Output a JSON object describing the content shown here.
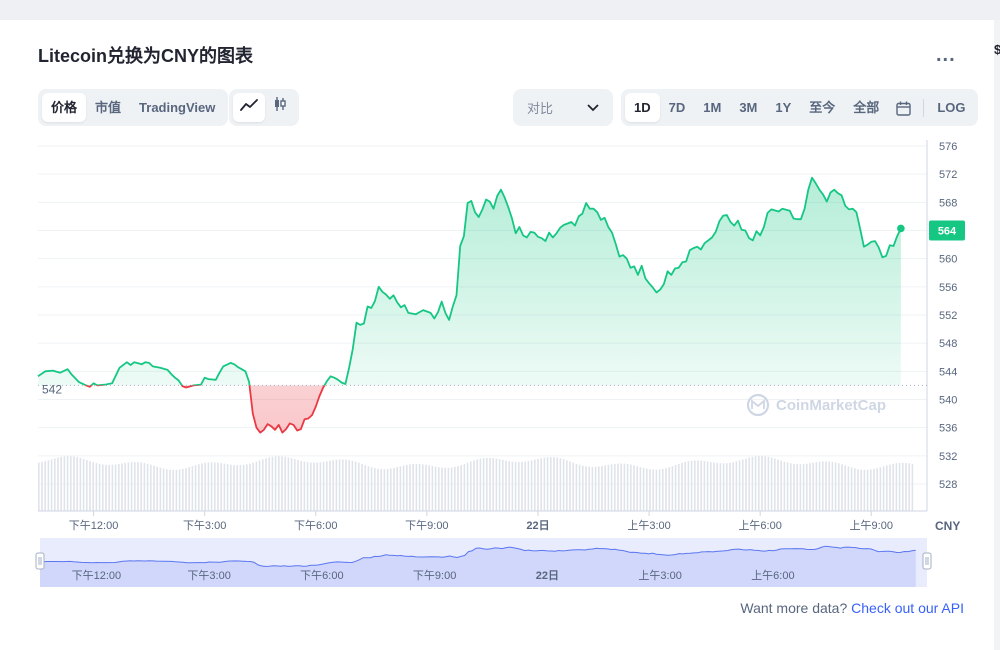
{
  "header": {
    "title": "Litecoin兑换为CNY的图表",
    "more_label": "..."
  },
  "tabs": {
    "price": "价格",
    "market_cap": "市值",
    "tradingview": "TradingView"
  },
  "chart_type_icons": [
    "line-chart-icon",
    "candlestick-icon"
  ],
  "compare": {
    "label": "对比"
  },
  "ranges": [
    "1D",
    "7D",
    "1M",
    "3M",
    "1Y",
    "至今",
    "全部"
  ],
  "ranges_active": "1D",
  "log_label": "LOG",
  "edge_text": "$",
  "colors": {
    "up": "#16c784",
    "down": "#ea3943",
    "navigator": "#a6b4f5",
    "accent_link": "#3861fb"
  },
  "chart_data": {
    "type": "line",
    "currency": "CNY",
    "y_ticks": [
      576,
      572,
      568,
      564,
      560,
      556,
      552,
      548,
      544,
      540,
      536,
      532,
      528
    ],
    "ylim": [
      525,
      578
    ],
    "reference_price": 542,
    "reference_label": "542",
    "current_price": 564,
    "current_label": "564",
    "x_labels": [
      "下午12:00",
      "下午3:00",
      "下午6:00",
      "下午9:00",
      "22日",
      "上午3:00",
      "上午6:00",
      "上午9:00"
    ],
    "x_label_hours": [
      1.5,
      4.5,
      7.5,
      10.5,
      13.5,
      16.5,
      19.5,
      22.5
    ],
    "x_range_hours": [
      0,
      23.6
    ],
    "navigator_labels": [
      "下午12:00",
      "下午3:00",
      "下午6:00",
      "下午9:00",
      "22日",
      "上午3:00",
      "上午6:00"
    ],
    "series": [
      {
        "values": [
          [
            0,
            543.3
          ],
          [
            0.2,
            544.0
          ],
          [
            0.4,
            544.1
          ],
          [
            0.6,
            543.8
          ],
          [
            0.8,
            544.3
          ],
          [
            0.9,
            543.6
          ],
          [
            1.1,
            542.5
          ],
          [
            1.3,
            542.0
          ],
          [
            1.4,
            541.8
          ],
          [
            1.5,
            542.3
          ],
          [
            1.6,
            542.0
          ],
          [
            1.8,
            542.1
          ],
          [
            2.0,
            542.3
          ],
          [
            2.2,
            544.5
          ],
          [
            2.4,
            545.3
          ],
          [
            2.5,
            544.9
          ],
          [
            2.6,
            545.3
          ],
          [
            2.8,
            545.0
          ],
          [
            2.9,
            545.3
          ],
          [
            3.0,
            545.2
          ],
          [
            3.1,
            544.7
          ],
          [
            3.3,
            544.5
          ],
          [
            3.5,
            544.2
          ],
          [
            3.6,
            543.6
          ],
          [
            3.7,
            543.1
          ],
          [
            3.8,
            542.7
          ],
          [
            3.9,
            541.9
          ],
          [
            4.0,
            541.7
          ],
          [
            4.2,
            542.0
          ],
          [
            4.4,
            542.1
          ],
          [
            4.5,
            543.1
          ],
          [
            4.6,
            542.9
          ],
          [
            4.8,
            542.8
          ],
          [
            4.9,
            543.8
          ],
          [
            5.0,
            544.7
          ],
          [
            5.2,
            545.2
          ],
          [
            5.3,
            545.0
          ],
          [
            5.4,
            544.6
          ],
          [
            5.5,
            544.3
          ],
          [
            5.6,
            544.0
          ],
          [
            5.7,
            542.5
          ],
          [
            5.8,
            538.0
          ],
          [
            5.9,
            536.0
          ],
          [
            6.0,
            535.3
          ],
          [
            6.1,
            535.7
          ],
          [
            6.2,
            536.5
          ],
          [
            6.3,
            536.2
          ],
          [
            6.4,
            535.7
          ],
          [
            6.5,
            536.4
          ],
          [
            6.6,
            535.3
          ],
          [
            6.7,
            535.8
          ],
          [
            6.8,
            536.6
          ],
          [
            6.9,
            536.4
          ],
          [
            7.0,
            535.6
          ],
          [
            7.1,
            535.8
          ],
          [
            7.2,
            537.2
          ],
          [
            7.3,
            537.3
          ],
          [
            7.4,
            537.8
          ],
          [
            7.5,
            539.0
          ],
          [
            7.6,
            540.5
          ],
          [
            7.7,
            541.7
          ],
          [
            7.8,
            542.6
          ],
          [
            7.9,
            543.3
          ],
          [
            8.0,
            543.1
          ],
          [
            8.1,
            542.8
          ],
          [
            8.2,
            542.4
          ],
          [
            8.3,
            542.2
          ],
          [
            8.4,
            544.5
          ],
          [
            8.5,
            547.2
          ],
          [
            8.6,
            550.9
          ],
          [
            8.7,
            550.6
          ],
          [
            8.8,
            550.8
          ],
          [
            8.9,
            553.2
          ],
          [
            9.0,
            553.0
          ],
          [
            9.1,
            554.0
          ],
          [
            9.2,
            556.0
          ],
          [
            9.3,
            555.3
          ],
          [
            9.4,
            554.9
          ],
          [
            9.5,
            554.3
          ],
          [
            9.6,
            554.8
          ],
          [
            9.7,
            553.8
          ],
          [
            9.8,
            553.1
          ],
          [
            9.9,
            553.4
          ],
          [
            10.0,
            552.3
          ],
          [
            10.2,
            552.1
          ],
          [
            10.4,
            552.7
          ],
          [
            10.6,
            552.3
          ],
          [
            10.7,
            551.5
          ],
          [
            10.8,
            552.4
          ],
          [
            10.9,
            553.9
          ],
          [
            11.0,
            552.3
          ],
          [
            11.1,
            551.3
          ],
          [
            11.2,
            553.2
          ],
          [
            11.3,
            554.8
          ],
          [
            11.4,
            561.8
          ],
          [
            11.5,
            563.2
          ],
          [
            11.6,
            567.9
          ],
          [
            11.7,
            568.2
          ],
          [
            11.8,
            566.6
          ],
          [
            11.9,
            565.9
          ],
          [
            12.0,
            567.0
          ],
          [
            12.1,
            568.4
          ],
          [
            12.2,
            568.1
          ],
          [
            12.3,
            567.1
          ],
          [
            12.4,
            568.9
          ],
          [
            12.5,
            569.8
          ],
          [
            12.6,
            568.7
          ],
          [
            12.7,
            567.3
          ],
          [
            12.8,
            565.7
          ],
          [
            12.9,
            563.6
          ],
          [
            13.0,
            564.5
          ],
          [
            13.1,
            563.3
          ],
          [
            13.2,
            563.0
          ],
          [
            13.3,
            563.8
          ],
          [
            13.4,
            563.7
          ],
          [
            13.5,
            563.1
          ],
          [
            13.6,
            562.9
          ],
          [
            13.7,
            562.5
          ],
          [
            13.8,
            563.7
          ],
          [
            13.9,
            563.0
          ],
          [
            14.0,
            563.6
          ],
          [
            14.1,
            564.4
          ],
          [
            14.2,
            564.8
          ],
          [
            14.3,
            565.0
          ],
          [
            14.4,
            565.2
          ],
          [
            14.5,
            564.7
          ],
          [
            14.6,
            566.0
          ],
          [
            14.7,
            566.4
          ],
          [
            14.8,
            567.9
          ],
          [
            14.9,
            567.1
          ],
          [
            15.0,
            567.1
          ],
          [
            15.1,
            566.6
          ],
          [
            15.2,
            565.5
          ],
          [
            15.3,
            565.8
          ],
          [
            15.4,
            564.5
          ],
          [
            15.5,
            563.7
          ],
          [
            15.6,
            562.1
          ],
          [
            15.7,
            560.3
          ],
          [
            15.8,
            560.5
          ],
          [
            15.9,
            560.0
          ],
          [
            16.0,
            558.7
          ],
          [
            16.1,
            558.9
          ],
          [
            16.2,
            557.7
          ],
          [
            16.3,
            559.0
          ],
          [
            16.4,
            557.2
          ],
          [
            16.5,
            556.5
          ],
          [
            16.6,
            555.9
          ],
          [
            16.7,
            555.2
          ],
          [
            16.8,
            555.6
          ],
          [
            16.9,
            556.4
          ],
          [
            17.0,
            558.2
          ],
          [
            17.1,
            557.7
          ],
          [
            17.2,
            558.6
          ],
          [
            17.3,
            558.7
          ],
          [
            17.4,
            559.5
          ],
          [
            17.5,
            559.6
          ],
          [
            17.6,
            561.2
          ],
          [
            17.7,
            561.5
          ],
          [
            17.8,
            561.7
          ],
          [
            17.9,
            561.3
          ],
          [
            18.0,
            562.2
          ],
          [
            18.1,
            562.6
          ],
          [
            18.2,
            563.0
          ],
          [
            18.3,
            563.8
          ],
          [
            18.4,
            565.3
          ],
          [
            18.5,
            566.1
          ],
          [
            18.6,
            566.2
          ],
          [
            18.7,
            565.2
          ],
          [
            18.8,
            564.7
          ],
          [
            18.9,
            565.4
          ],
          [
            19.0,
            564.1
          ],
          [
            19.1,
            564.0
          ],
          [
            19.2,
            562.9
          ],
          [
            19.3,
            562.6
          ],
          [
            19.4,
            563.9
          ],
          [
            19.5,
            563.3
          ],
          [
            19.6,
            564.5
          ],
          [
            19.7,
            566.5
          ],
          [
            19.8,
            567.0
          ],
          [
            20.0,
            566.7
          ],
          [
            20.1,
            567.1
          ],
          [
            20.3,
            566.8
          ],
          [
            20.4,
            565.7
          ],
          [
            20.5,
            565.6
          ],
          [
            20.6,
            565.6
          ],
          [
            20.7,
            567.1
          ],
          [
            20.8,
            569.8
          ],
          [
            20.9,
            571.5
          ],
          [
            21.0,
            570.7
          ],
          [
            21.1,
            569.8
          ],
          [
            21.2,
            569.1
          ],
          [
            21.3,
            568.1
          ],
          [
            21.4,
            569.4
          ],
          [
            21.5,
            569.8
          ],
          [
            21.6,
            569.3
          ],
          [
            21.7,
            569.0
          ],
          [
            21.8,
            567.5
          ],
          [
            21.9,
            567.0
          ],
          [
            22.0,
            567.1
          ],
          [
            22.1,
            566.6
          ],
          [
            22.2,
            564.2
          ],
          [
            22.3,
            561.7
          ],
          [
            22.4,
            562.0
          ],
          [
            22.5,
            562.4
          ],
          [
            22.6,
            562.5
          ],
          [
            22.7,
            561.6
          ],
          [
            22.8,
            560.2
          ],
          [
            22.9,
            560.4
          ],
          [
            23.0,
            561.9
          ],
          [
            23.1,
            561.8
          ],
          [
            23.2,
            563.2
          ],
          [
            23.3,
            564.3
          ]
        ]
      }
    ]
  },
  "watermark": "CoinMarketCap",
  "footer": {
    "prefix": "Want more data?",
    "link": "Check out our API"
  }
}
